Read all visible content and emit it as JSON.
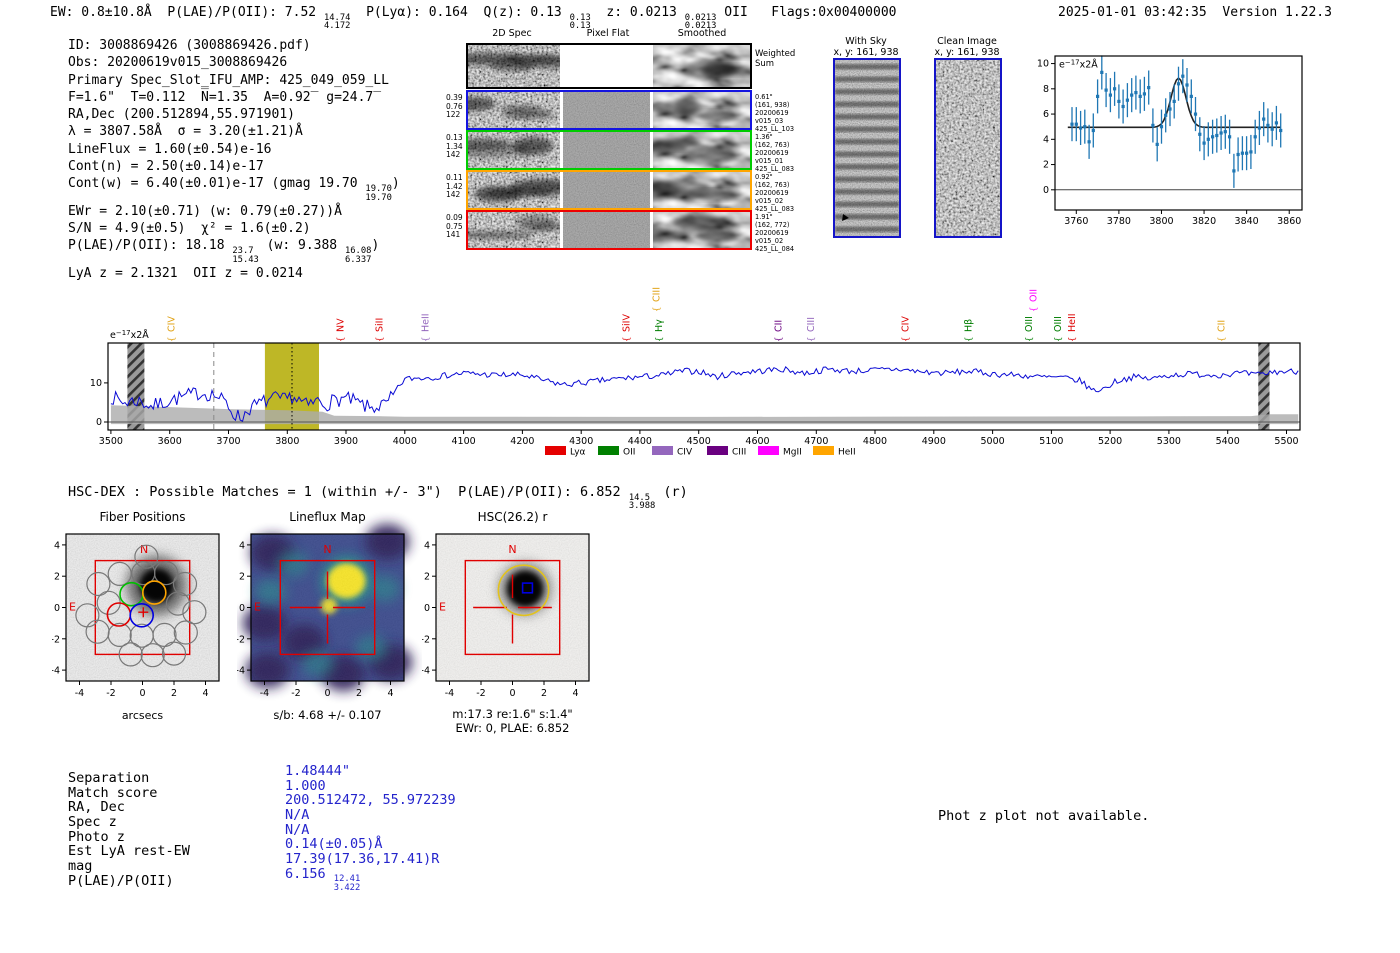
{
  "header": {
    "left_segments": [
      {
        "t": "EW: 0.8±10.8Å  P(LAE)/P(OII): 7.52 "
      },
      {
        "f": [
          "14.74",
          "4.172"
        ]
      },
      {
        "t": "  P(Lyα): 0.164  Q(z): 0.13 "
      },
      {
        "f": [
          "0.13",
          "0.13"
        ]
      },
      {
        "t": "  z: 0.0213 "
      },
      {
        "f": [
          "0.0213",
          "0.0213"
        ]
      },
      {
        "t": " OII   Flags:0x00400000"
      }
    ],
    "datetime": "2025-01-01 03:42:35",
    "version": "Version 1.22.3"
  },
  "info_block": {
    "lines": [
      [
        {
          "t": "ID: 3008869426 (3008869426.pdf)"
        }
      ],
      [
        {
          "t": "Obs: 20200619v015_3008869426"
        }
      ],
      [
        {
          "t": "Primary Spec_Slot_IFU_AMP: 425_049_059_LL"
        }
      ],
      [
        {
          "t": "F=1.6\"  T=0.112  N̅=1.35  A=0.92̅  g=24.7̅"
        }
      ],
      [
        {
          "t": "RA,Dec (200.512894,55.971901)"
        }
      ],
      [
        {
          "t": "λ = 3807.58Å  σ = 3.20(±1.21)Å"
        }
      ],
      [
        {
          "t": "LineFlux = 1.60(±0.54)e-16"
        }
      ],
      [
        {
          "t": "Cont(n) = 2.50(±0.14)e-17"
        }
      ],
      [
        {
          "t": "Cont(w) = 6.40(±0.01)e-17 (gmag 19.70 "
        },
        {
          "f": [
            "19.70",
            "19.70"
          ]
        },
        {
          "t": ")"
        }
      ],
      [
        {
          "t": "EWr = 2.10(±0.71) (w: 0.79(±0.27))Å"
        }
      ],
      [
        {
          "t": "S/N = 4.9(±0.5)  χ² = 1.6(±0.2)"
        }
      ],
      [
        {
          "t": "P(LAE)/P(OII): 18.18 "
        },
        {
          "f": [
            "23.7",
            "15.43"
          ]
        },
        {
          "t": " (w: 9.388 "
        },
        {
          "f": [
            "16.08",
            "6.337"
          ]
        },
        {
          "t": ")"
        }
      ],
      [
        {
          "t": "LyA z = 2.1321  OII z = 0.0214"
        }
      ]
    ]
  },
  "spec2d": {
    "col_headers": [
      "2D Spec",
      "Pixel Flat",
      "Smoothed"
    ],
    "weighted_sum_label": [
      "Weighted",
      "Sum"
    ],
    "rows": [
      {
        "border": "#000000",
        "kinds": [
          "dark",
          "white",
          "smooth"
        ],
        "left": [],
        "right": []
      },
      {
        "border": "#1414e0",
        "kinds": [
          "noise",
          "flat",
          "smooth"
        ],
        "left": [
          "0.39",
          "0.76",
          "122"
        ],
        "right": [
          "0.61\"",
          "(161, 938)",
          "20200619",
          "v015_03",
          "425_LL_103"
        ]
      },
      {
        "border": "#00cc00",
        "kinds": [
          "noise",
          "flat",
          "smooth"
        ],
        "left": [
          "0.13",
          "1.34",
          "142"
        ],
        "right": [
          "1.36\"",
          "(162, 763)",
          "20200619",
          "v015_01",
          "425_LL_083"
        ]
      },
      {
        "border": "#ffa500",
        "kinds": [
          "noise",
          "flat",
          "smooth"
        ],
        "left": [
          "0.11",
          "1.42",
          "142"
        ],
        "right": [
          "0.92\"",
          "(162, 763)",
          "20200619",
          "v015_02",
          "425_LL_083"
        ]
      },
      {
        "border": "#ee0000",
        "kinds": [
          "noise",
          "flat",
          "smooth"
        ],
        "left": [
          "0.09",
          "0.75",
          "141"
        ],
        "right": [
          "1.91\"",
          "(162, 772)",
          "20200619",
          "v015_02",
          "425_LL_084"
        ]
      }
    ]
  },
  "sky_panels": [
    {
      "title": "With Sky",
      "subtitle": "x, y: 161, 938",
      "kind": "sky"
    },
    {
      "title": "Clean Image",
      "subtitle": "x, y: 161, 938",
      "kind": "clean"
    }
  ],
  "hsc_dex": {
    "segments": [
      {
        "t": "HSC-DEX : Possible Matches = 1 (within +/- 3\")  P(LAE)/P(OII): 6.852 "
      },
      {
        "f": [
          "14.5",
          "3.988"
        ]
      },
      {
        "t": " (r)"
      }
    ]
  },
  "match_table": {
    "rows": [
      {
        "label": "Separation",
        "value": [
          {
            "t": "1.48444\""
          }
        ]
      },
      {
        "label": "Match score",
        "value": [
          {
            "t": "1.000"
          }
        ]
      },
      {
        "label": "RA, Dec",
        "value": [
          {
            "t": "200.512472, 55.972239"
          }
        ]
      },
      {
        "label": "Spec z",
        "value": [
          {
            "t": "N/A"
          }
        ]
      },
      {
        "label": "Photo z",
        "value": [
          {
            "t": "N/A"
          }
        ]
      },
      {
        "label": "Est LyA rest-EW",
        "value": [
          {
            "t": "0.14(±0.05)Å"
          }
        ]
      },
      {
        "label": "mag",
        "value": [
          {
            "t": "17.39(17.36,17.41)R"
          }
        ]
      },
      {
        "label": "P(LAE)/P(OII)",
        "value": [
          {
            "t": "6.156 "
          },
          {
            "f": [
              "12.41",
              "3.422"
            ]
          }
        ]
      }
    ]
  },
  "photz_note": "Phot z plot not available.",
  "chart_data": [
    {
      "id": "zoom_spectrum",
      "type": "line",
      "annotation": "e−17x2Å",
      "xlim": [
        3750,
        3866
      ],
      "ylim": [
        -1.6,
        10.6
      ],
      "xticks": [
        3760,
        3780,
        3800,
        3820,
        3840,
        3860
      ],
      "yticks": [
        0,
        2,
        4,
        6,
        8,
        10
      ],
      "fit": {
        "continuum": 4.95,
        "center": 3808,
        "sigma": 3.5,
        "amp": 3.9
      },
      "points": {
        "x_start": 3758,
        "dx": 2,
        "err": 1.35,
        "y": [
          5.2,
          5.2,
          4.9,
          5.0,
          3.8,
          4.7,
          7.4,
          9.3,
          7.9,
          7.5,
          8.0,
          7.0,
          6.6,
          7.1,
          7.5,
          7.7,
          7.4,
          7.6,
          8.1,
          5.1,
          3.6,
          5.0,
          5.9,
          6.4,
          7.0,
          8.4,
          9.0,
          8.3,
          7.4,
          6.0,
          4.4,
          3.7,
          4.0,
          4.2,
          4.3,
          4.5,
          4.6,
          4.2,
          1.5,
          2.8,
          2.9,
          2.9,
          3.0,
          4.2,
          4.9,
          5.6,
          5.1,
          4.8,
          5.3,
          4.7
        ]
      },
      "point_color": "#1f77b4",
      "fit_color": "#222222"
    },
    {
      "id": "full_spectrum",
      "type": "line",
      "annotation": "e−17x2Å",
      "xlim": [
        3495,
        5523
      ],
      "ylim": [
        -2.05,
        20.2
      ],
      "xticks": [
        3500,
        3600,
        3700,
        3800,
        3900,
        4000,
        4100,
        4200,
        4300,
        4400,
        4500,
        4600,
        4700,
        4800,
        4900,
        5000,
        5100,
        5200,
        5300,
        5400,
        5500
      ],
      "yticks": [
        0,
        10
      ],
      "line_color": "#0a0ad4",
      "bands": [
        {
          "type": "hatch",
          "x0": 3528,
          "x1": 3557
        },
        {
          "type": "olive",
          "x0": 3762,
          "x1": 3854,
          "color": "#b3aa00"
        },
        {
          "type": "hatch",
          "x0": 5452,
          "x1": 5471
        }
      ],
      "vlines": [
        {
          "x": 3675,
          "style": "dashed",
          "color": "#888888"
        },
        {
          "x": 3808,
          "style": "dotted",
          "color": "#000000"
        }
      ],
      "anchors_x": [
        3500,
        3520,
        3545,
        3570,
        3600,
        3625,
        3650,
        3675,
        3695,
        3710,
        3722,
        3735,
        3750,
        3765,
        3780,
        3795,
        3808,
        3820,
        3835,
        3850,
        3865,
        3880,
        3895,
        3910,
        3925,
        3940,
        3955,
        3970,
        3985,
        4000,
        4050,
        4100,
        4150,
        4200,
        4240,
        4270,
        4300,
        4330,
        4360,
        4400,
        4440,
        4470,
        4500,
        4530,
        4560,
        4600,
        4640,
        4680,
        4720,
        4760,
        4800,
        4840,
        4880,
        4920,
        4960,
        5000,
        5040,
        5080,
        5120,
        5150,
        5170,
        5190,
        5210,
        5240,
        5270,
        5300,
        5340,
        5380,
        5420,
        5450,
        5480,
        5520
      ],
      "anchors_y": [
        6.5,
        5.0,
        5.5,
        4.0,
        5.5,
        6.5,
        7.5,
        7.0,
        5.0,
        2.0,
        1.0,
        3.5,
        4.5,
        5.5,
        6.0,
        5.5,
        6.5,
        5.5,
        4.0,
        5.5,
        4.5,
        5.5,
        6.0,
        5.5,
        4.5,
        3.5,
        4.0,
        4.5,
        8.0,
        11.0,
        11.5,
        12.5,
        12.0,
        12.0,
        10.5,
        9.5,
        10.0,
        10.5,
        11.0,
        11.5,
        12.0,
        13.0,
        13.0,
        11.5,
        12.5,
        13.0,
        13.5,
        12.5,
        13.5,
        13.0,
        13.3,
        13.5,
        12.8,
        12.5,
        13.0,
        12.3,
        12.0,
        11.5,
        11.3,
        10.5,
        8.0,
        8.5,
        10.5,
        11.5,
        11.0,
        12.0,
        12.3,
        12.0,
        12.5,
        12.0,
        12.8,
        13.0
      ],
      "noise_amp_blue": 1.9,
      "noise_amp_red": 0.8,
      "err_x": [
        3500,
        3600,
        3700,
        3800,
        3860,
        3880,
        3950,
        4000,
        4500,
        5000,
        5300,
        5440,
        5470,
        5520
      ],
      "err_h": [
        4.3,
        3.8,
        3.3,
        3.0,
        2.6,
        1.6,
        1.5,
        1.35,
        1.3,
        1.4,
        1.45,
        1.5,
        2.0,
        2.0
      ],
      "line_labels": [
        {
          "name": "CIV",
          "wl": 3602,
          "color": "#e0a010",
          "row": 0
        },
        {
          "name": "NV",
          "wl": 3890,
          "color": "#dd0000",
          "row": 0
        },
        {
          "name": "SiII",
          "wl": 3956,
          "color": "#dd0000",
          "row": 0
        },
        {
          "name": "HeII",
          "wl": 4034,
          "color": "#9467bd",
          "row": 0
        },
        {
          "name": "SiIV",
          "wl": 4376,
          "color": "#dd0000",
          "row": 0
        },
        {
          "name": "Hγ",
          "wl": 4432,
          "color": "#007d00",
          "row": 0
        },
        {
          "name": "CIII",
          "wl": 4427,
          "color": "#e0a010",
          "row": 1
        },
        {
          "name": "CII",
          "wl": 4635,
          "color": "#6a0080",
          "row": 0
        },
        {
          "name": "CIII",
          "wl": 4690,
          "color": "#9467bd",
          "row": 0
        },
        {
          "name": "CIV",
          "wl": 4851,
          "color": "#dd0000",
          "row": 0
        },
        {
          "name": "Hβ",
          "wl": 4958,
          "color": "#007d00",
          "row": 0
        },
        {
          "name": "OIII",
          "wl": 5061,
          "color": "#007d00",
          "row": 0
        },
        {
          "name": "OII",
          "wl": 5069,
          "color": "#ff00ff",
          "row": 1
        },
        {
          "name": "OIII",
          "wl": 5110,
          "color": "#007d00",
          "row": 0
        },
        {
          "name": "HeII",
          "wl": 5134,
          "color": "#dd0000",
          "row": 0
        },
        {
          "name": "CII",
          "wl": 5389,
          "color": "#e0a010",
          "row": 0
        }
      ],
      "legend": [
        {
          "label": "Lyα",
          "color": "#e50000"
        },
        {
          "label": "OII",
          "color": "#008000"
        },
        {
          "label": "CIV",
          "color": "#9467bd"
        },
        {
          "label": "CIII",
          "color": "#6a0080"
        },
        {
          "label": "MgII",
          "color": "#ff00ff"
        },
        {
          "label": "HeII",
          "color": "#ffa500"
        }
      ]
    },
    {
      "id": "fiber_positions",
      "type": "cutout",
      "title": "Fiber Positions",
      "xlabel": "arcsecs",
      "ticks": [
        -4,
        -2,
        0,
        2,
        4
      ],
      "square": 3,
      "compass": {
        "n": [
          0.1,
          3.5
        ],
        "e": [
          -4.45,
          -0.2
        ]
      },
      "cross": [
        0.05,
        -0.3
      ],
      "blob": [
        0.9,
        1.4,
        1.9
      ],
      "fiber_radius": 0.73,
      "fibers_gray": [
        [
          0.25,
          3.25
        ],
        [
          -1.45,
          2.15
        ],
        [
          0.05,
          2.2
        ],
        [
          1.5,
          2.2
        ],
        [
          2.7,
          1.5
        ],
        [
          -2.8,
          1.5
        ],
        [
          -2.15,
          0.3
        ],
        [
          2.25,
          0.25
        ],
        [
          3.3,
          -0.3
        ],
        [
          -3.5,
          -0.5
        ],
        [
          -2.85,
          -1.55
        ],
        [
          -1.45,
          -1.75
        ],
        [
          -0.05,
          -1.8
        ],
        [
          1.4,
          -1.75
        ],
        [
          2.75,
          -1.6
        ],
        [
          -0.75,
          -3.0
        ],
        [
          0.65,
          -3.05
        ],
        [
          2.0,
          -2.95
        ]
      ],
      "fibers_colored": [
        {
          "color": "#00c000",
          "x": -0.7,
          "y": 0.85
        },
        {
          "color": "#ffa500",
          "x": 0.75,
          "y": 0.95
        },
        {
          "color": "#e00000",
          "x": -1.5,
          "y": -0.45
        },
        {
          "color": "#0000e0",
          "x": -0.05,
          "y": -0.5
        }
      ]
    },
    {
      "id": "lineflux_map",
      "type": "cutout",
      "title": "Lineflux Map",
      "caption": "s/b: 4.68 +/- 0.107",
      "ticks": [
        -4,
        -2,
        0,
        2,
        4
      ],
      "square": 3,
      "compass": {
        "n": [
          0.0,
          3.5
        ],
        "e": [
          -4.45,
          -0.2
        ]
      },
      "blob": [
        1.2,
        1.7,
        1.6
      ],
      "colors": {
        "base": "#3b4a8c",
        "dark": "#2a1a55",
        "teal": "#21918c",
        "peak": "#f7e425"
      }
    },
    {
      "id": "hsc_r",
      "type": "cutout",
      "title": "HSC(26.2) r",
      "caption1": "m:17.3  re:1.6\"  s:1.4\"",
      "caption2": "EWr: 0, PLAE: 6.852",
      "ticks": [
        -4,
        -2,
        0,
        2,
        4
      ],
      "square": 3,
      "compass": {
        "n": [
          0.0,
          3.5
        ],
        "e": [
          -4.45,
          -0.2
        ]
      },
      "blob": [
        0.8,
        1.2,
        1.15
      ],
      "aperture": {
        "circle": [
          0.7,
          1.1,
          1.6
        ],
        "circle_color": "#e2c21d",
        "bluebox": [
          0.95,
          1.25,
          0.62
        ],
        "bluebox_color": "#0000e0"
      }
    }
  ]
}
